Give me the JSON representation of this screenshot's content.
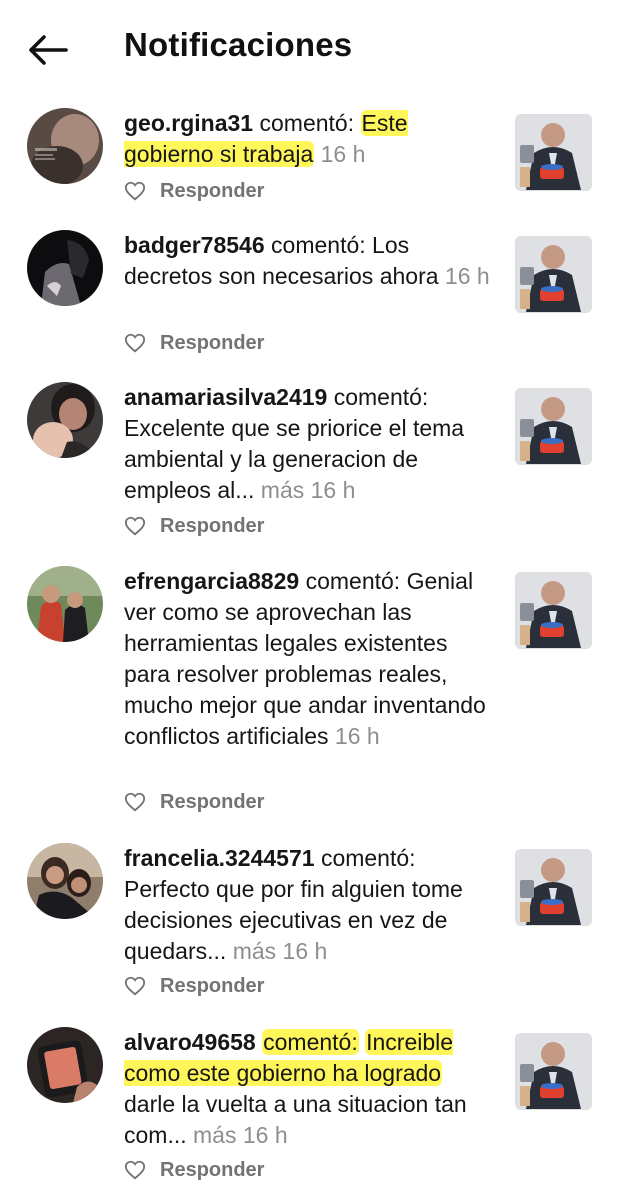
{
  "header": {
    "title": "Notificaciones",
    "back_icon": "arrow-left-icon"
  },
  "ui": {
    "reply_label": "Responder",
    "more_label": "más",
    "commented_label": "comentó:",
    "highlight_color": "#FFF53C"
  },
  "notifications": [
    {
      "username": "geo.rgina31",
      "comment_pre": "",
      "comment_hl": "Este gobierno si trabaja",
      "comment_post": "",
      "truncated": false,
      "time": "16 h"
    },
    {
      "username": "badger78546",
      "comment_pre": "Los decretos son necesarios ahora",
      "truncated": false,
      "time": "16 h"
    },
    {
      "username": "anamariasilva2419",
      "comment_pre": "Excelente que se priorice el tema ambiental y la generacion de empleos al...",
      "truncated": true,
      "time": "16 h"
    },
    {
      "username": "efrengarcia8829",
      "comment_pre": "Genial ver como se aprovechan las herramientas legales existentes para resolver problemas reales, mucho mejor que andar inventando conflictos artificiales",
      "truncated": false,
      "time": "16 h"
    },
    {
      "username": "francelia.3244571",
      "comment_pre": "Perfecto que por fin alguien tome decisiones ejecutivas en vez de quedars...",
      "truncated": true,
      "time": "16 h"
    },
    {
      "username": "alvaro49658",
      "comment_hl": "Increible como este gobierno ha logrado",
      "comment_post": "darle la vuelta a una situacion tan com...",
      "truncated": true,
      "time": "16 h"
    }
  ]
}
